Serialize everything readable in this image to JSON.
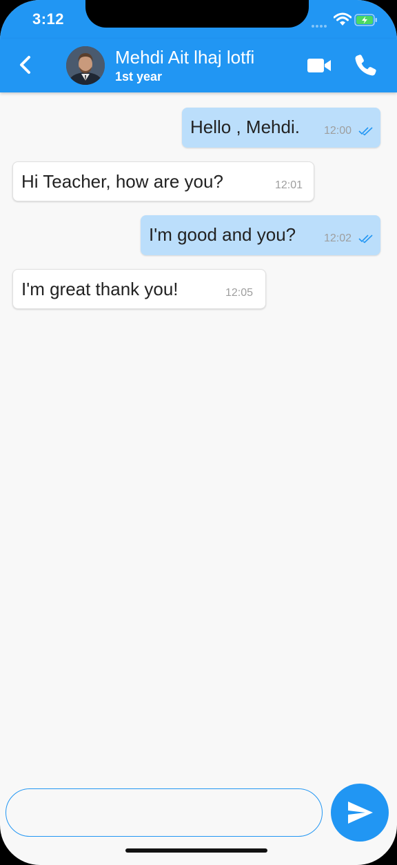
{
  "status_bar": {
    "time": "3:12"
  },
  "header": {
    "contact_name": "Mehdi Ait lhaj lotfi",
    "contact_subtitle": "1st year",
    "accent_color": "#2196f3",
    "icons": {
      "back": "back-chevron-icon",
      "video": "video-camera-icon",
      "call": "phone-icon"
    }
  },
  "messages": [
    {
      "direction": "outgoing",
      "text": "Hello , Mehdi.",
      "time": "12:00",
      "read": true
    },
    {
      "direction": "incoming",
      "text": "Hi Teacher, how are you?",
      "time": "12:01",
      "read": false
    },
    {
      "direction": "outgoing",
      "text": "I'm good and you?",
      "time": "12:02",
      "read": true
    },
    {
      "direction": "incoming",
      "text": "I'm great thank you!",
      "time": "12:05",
      "read": false
    }
  ],
  "composer": {
    "value": "",
    "placeholder": "",
    "send_icon": "send-icon"
  },
  "colors": {
    "outgoing_bubble": "#bbdefb",
    "incoming_bubble": "#ffffff",
    "read_check": "#2196f3"
  }
}
